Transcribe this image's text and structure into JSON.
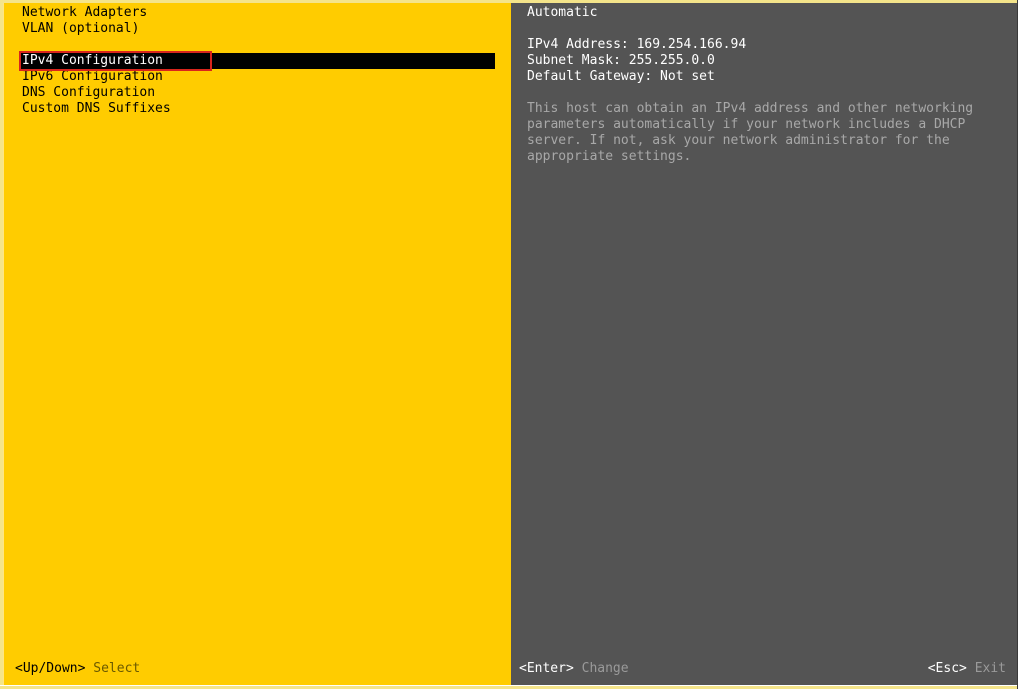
{
  "menu": {
    "items": [
      {
        "label": "Network Adapters"
      },
      {
        "label": "VLAN (optional)"
      },
      {
        "label": ""
      },
      {
        "label": "IPv4 Configuration",
        "selected": true
      },
      {
        "label": "IPv6 Configuration"
      },
      {
        "label": "DNS Configuration"
      },
      {
        "label": "Custom DNS Suffixes"
      }
    ]
  },
  "details": {
    "mode": "Automatic",
    "ipv4_address": "IPv4 Address: 169.254.166.94",
    "subnet_mask": "Subnet Mask: 255.255.0.0",
    "default_gateway": "Default Gateway: Not set",
    "description": "This host can obtain an IPv4 address and other networking\nparameters automatically if your network includes a DHCP\nserver. If not, ask your network administrator for the\nappropriate settings."
  },
  "footer": {
    "navigate_key": "<Up/Down>",
    "navigate_action": "Select",
    "change_key": "<Enter>",
    "change_action": "Change",
    "exit_key": "<Esc>",
    "exit_action": "Exit"
  },
  "colors": {
    "left_panel": "#ffcc00",
    "right_panel": "#545454",
    "selection_bg": "#000000",
    "highlight_box": "#d9251c"
  }
}
